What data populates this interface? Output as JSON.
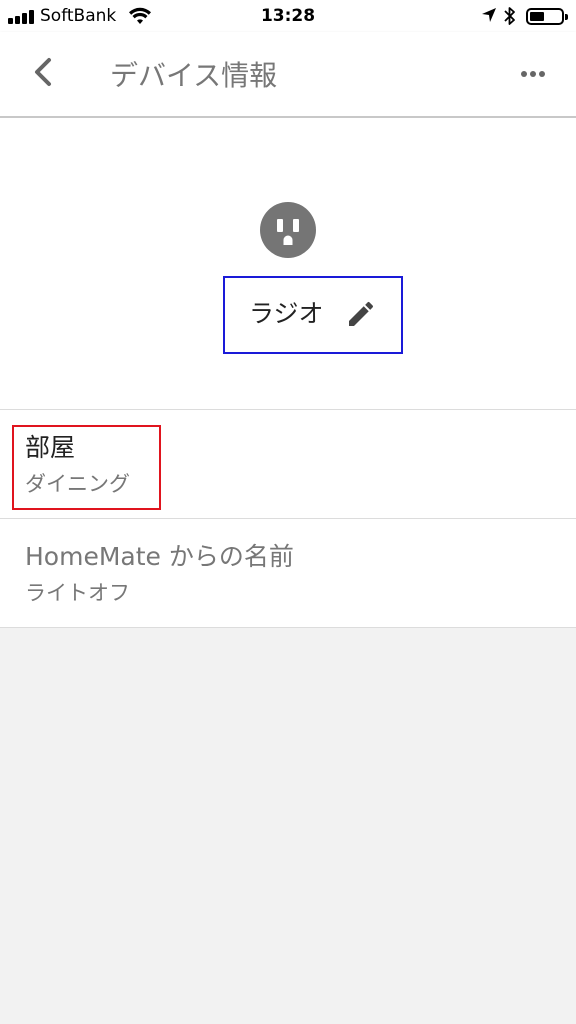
{
  "status_bar": {
    "carrier": "SoftBank",
    "time": "13:28"
  },
  "app_bar": {
    "title": "デバイス情報"
  },
  "device": {
    "name": "ラジオ",
    "icon": "power-outlet-icon"
  },
  "rows": [
    {
      "label": "部屋",
      "value": "ダイニング"
    },
    {
      "label": "HomeMate からの名前",
      "value": "ライトオフ"
    }
  ],
  "colors": {
    "app_bar_bg": "#ffffff",
    "page_bg": "#f2f2f2",
    "icon_gray": "#757575",
    "name_highlight": "#1a1ad8",
    "room_highlight": "#e0141e"
  }
}
